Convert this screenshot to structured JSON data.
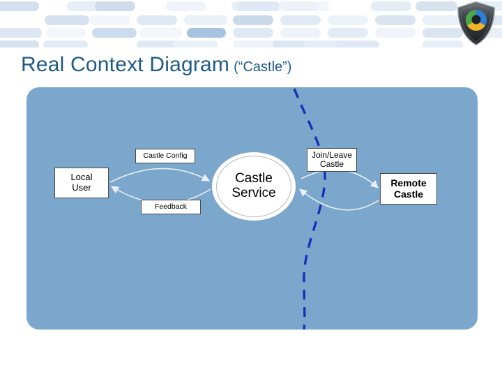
{
  "header": {
    "brand_icon": "shield-logo-icon",
    "brand_colors": [
      "#2f7ed8",
      "#4aa84a",
      "#f0b429",
      "#3a3a3a"
    ],
    "band_color": "#dde7f2"
  },
  "title": {
    "main": "Real Context Diagram",
    "sub": "(“Castle”)",
    "color": "#1f5b86"
  },
  "panel": {
    "background_color": "#7ba7cc",
    "boundary_line_color": "#1a2fb8",
    "boundary_line_style": "dashed"
  },
  "diagram": {
    "nodes": [
      {
        "id": "local-user",
        "label_line1": "Local",
        "label_line2": "User",
        "shape": "rectangle"
      },
      {
        "id": "castle-service",
        "label_line1": "Castle",
        "label_line2": "Service",
        "shape": "circle"
      },
      {
        "id": "remote-castle",
        "label_line1": "Remote",
        "label_line2": "Castle",
        "shape": "rectangle"
      }
    ],
    "flow_labels": [
      {
        "id": "castle-config",
        "text": "Castle Config"
      },
      {
        "id": "feedback",
        "text": "Feedback"
      },
      {
        "id": "join-leave-castle",
        "line1": "Join/Leave",
        "line2": "Castle"
      }
    ],
    "arrow_color": "#e8eef3"
  }
}
